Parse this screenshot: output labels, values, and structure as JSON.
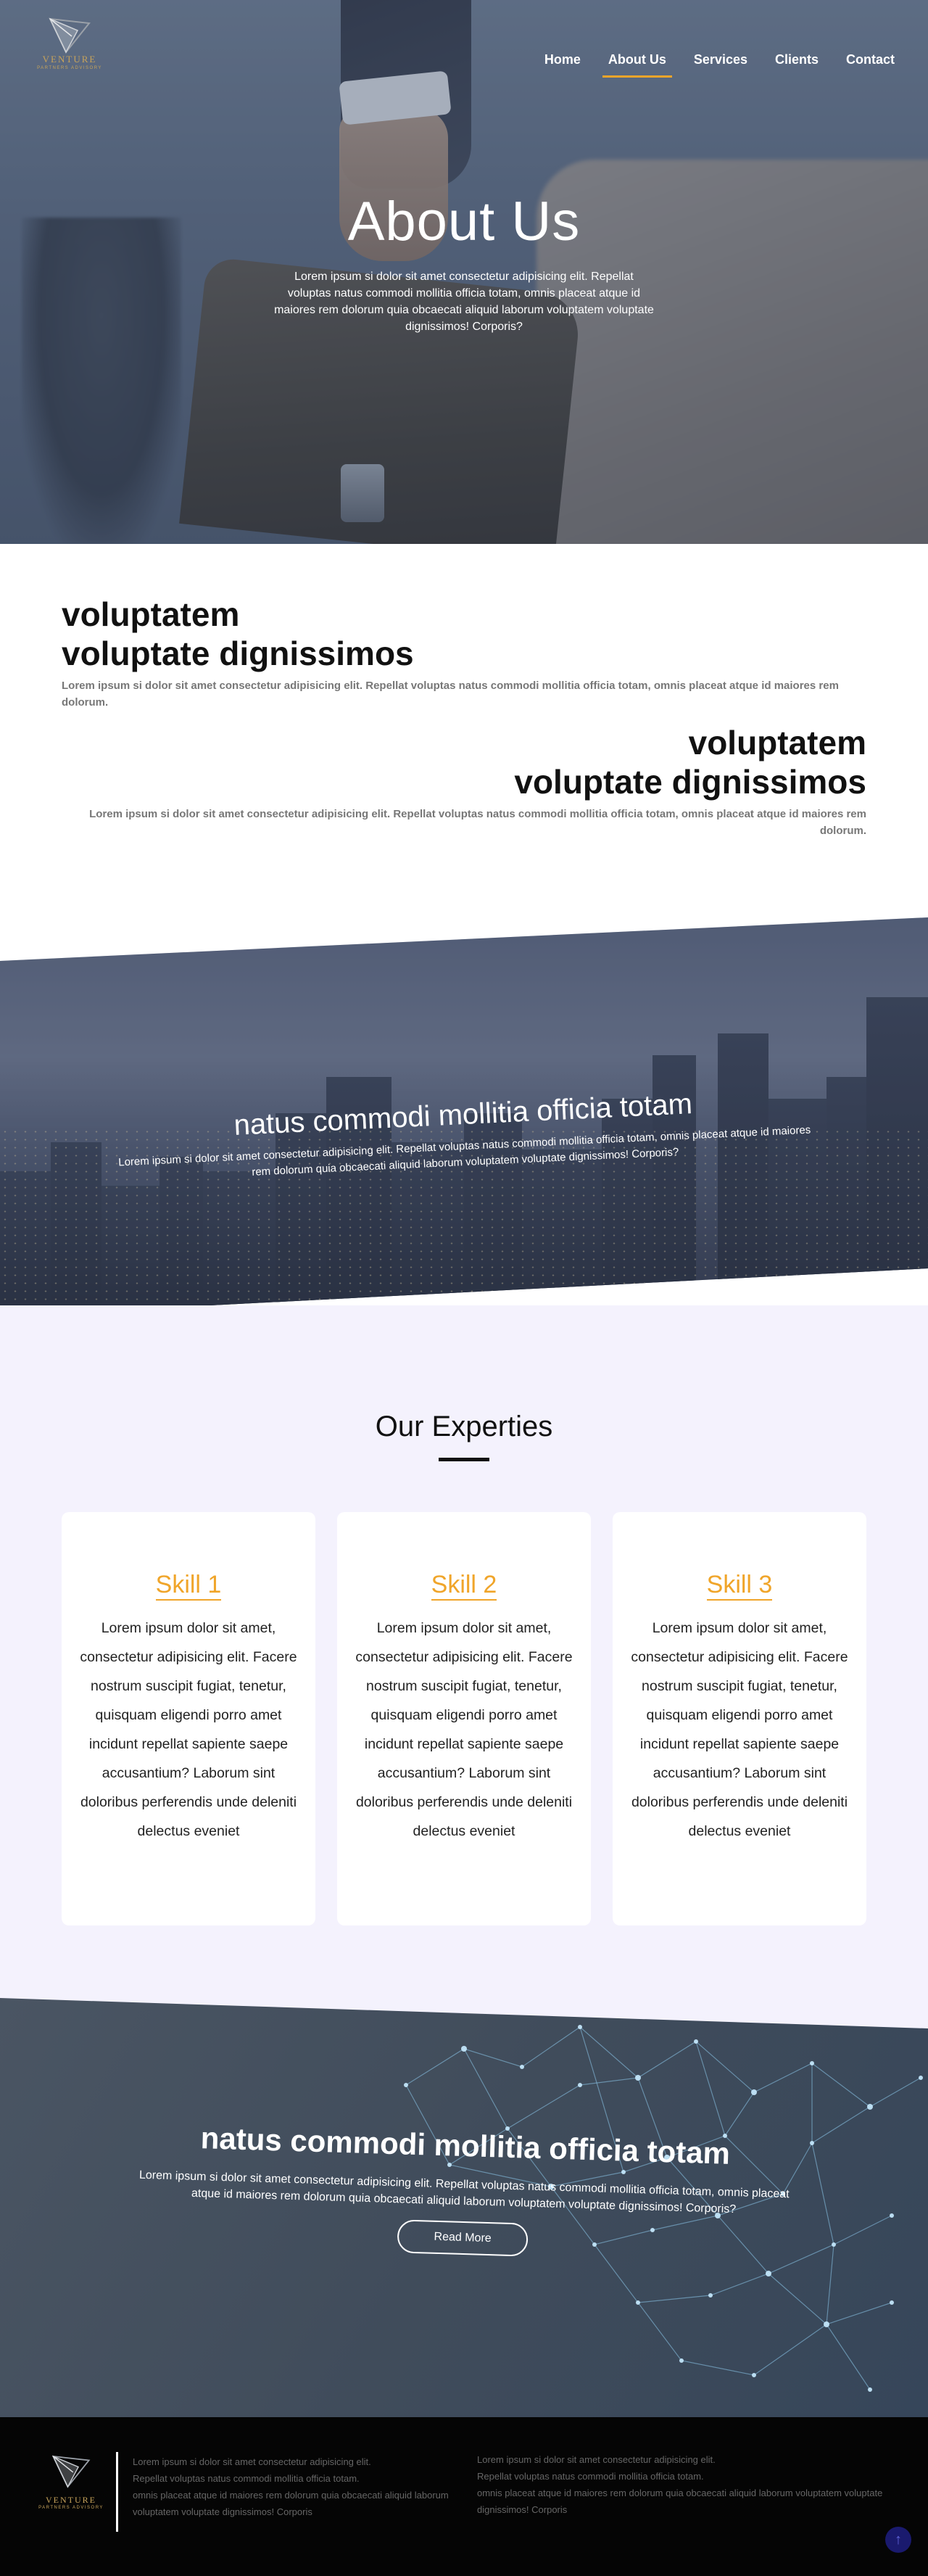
{
  "brand": {
    "name": "VENTURE",
    "tagline": "PARTNERS ADVISORY",
    "accent": "#f0a52a",
    "logo_color": "#c7a35a"
  },
  "nav": {
    "items": [
      {
        "label": "Home",
        "active": false
      },
      {
        "label": "About Us",
        "active": true
      },
      {
        "label": "Services",
        "active": false
      },
      {
        "label": "Clients",
        "active": false
      },
      {
        "label": "Contact",
        "active": false
      }
    ]
  },
  "hero": {
    "title": "About Us",
    "lead": "Lorem ipsum si dolor sit amet consectetur adipisicing elit. Repellat voluptas natus commodi mollitia officia totam, omnis placeat atque id maiores rem dolorum quia obcaecati aliquid laborum voluptatem voluptate dignissimos! Corporis?"
  },
  "about": {
    "blocks": [
      {
        "heading_line1": "voluptatem",
        "heading_line2": "voluptate dignissimos",
        "text": "Lorem ipsum si dolor sit amet consectetur adipisicing elit. Repellat voluptas natus commodi mollitia officia totam, omnis placeat atque id maiores rem dolorum."
      },
      {
        "heading_line1": "voluptatem",
        "heading_line2": "voluptate dignissimos",
        "text": "Lorem ipsum si dolor sit amet consectetur adipisicing elit. Repellat voluptas natus commodi mollitia officia totam, omnis placeat atque id maiores rem dolorum."
      }
    ]
  },
  "city_banner": {
    "title": "natus commodi mollitia officia totam",
    "text": "Lorem ipsum si dolor sit amet consectetur adipisicing elit. Repellat voluptas natus commodi mollitia officia totam, omnis placeat atque id maiores rem dolorum quia obcaecati aliquid laborum voluptatem voluptate dignissimos! Corporis?"
  },
  "expertise": {
    "title": "Our Experties",
    "cards": [
      {
        "title": "Skill 1",
        "text": "Lorem ipsum dolor sit amet, consectetur adipisicing elit. Facere nostrum suscipit fugiat, tenetur, quisquam eligendi porro amet incidunt repellat sapiente saepe accusantium? Laborum sint doloribus perferendis unde deleniti delectus eveniet"
      },
      {
        "title": "Skill 2",
        "text": "Lorem ipsum dolor sit amet, consectetur adipisicing elit. Facere nostrum suscipit fugiat, tenetur, quisquam eligendi porro amet incidunt repellat sapiente saepe accusantium? Laborum sint doloribus perferendis unde deleniti delectus eveniet"
      },
      {
        "title": "Skill 3",
        "text": "Lorem ipsum dolor sit amet, consectetur adipisicing elit. Facere nostrum suscipit fugiat, tenetur, quisquam eligendi porro amet incidunt repellat sapiente saepe accusantium? Laborum sint doloribus perferendis unde deleniti delectus eveniet"
      }
    ]
  },
  "network_banner": {
    "title": "natus commodi mollitia officia totam",
    "text": "Lorem ipsum si dolor sit amet consectetur adipisicing elit. Repellat voluptas natus commodi mollitia officia totam, omnis placeat atque id maiores rem dolorum quia obcaecati aliquid laborum voluptatem voluptate dignissimos! Corporis?",
    "button": "Read More"
  },
  "footer": {
    "col1": [
      "Lorem ipsum si dolor sit amet consectetur adipisicing elit.",
      "Repellat voluptas natus commodi mollitia officia totam.",
      "omnis placeat atque id maiores rem dolorum quia obcaecati aliquid laborum",
      "voluptatem voluptate dignissimos! Corporis"
    ],
    "col2": [
      "Lorem ipsum si dolor sit amet consectetur adipisicing elit.",
      "Repellat voluptas natus commodi mollitia officia totam.",
      "omnis placeat atque id maiores rem dolorum quia obcaecati aliquid laborum voluptatem voluptate",
      "dignissimos! Corporis"
    ],
    "to_top_icon": "arrow-up-icon"
  }
}
